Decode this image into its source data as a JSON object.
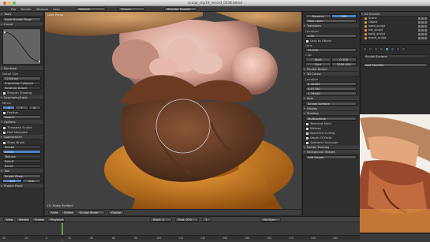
{
  "window": {
    "title": "sculpt_clip19_record_0038.blend"
  },
  "menubar": {
    "items": [
      "File",
      "Render",
      "Window",
      "Help"
    ],
    "layout": "Default",
    "scene": "Scene",
    "engine": "Blender Render"
  },
  "tool_panel": {
    "header": "Tools",
    "brush_field": "Input Sculpt Draw",
    "curve_title": "Curve",
    "dyntopo_title": "Dyntopo",
    "detail_size_label": "Detail Size",
    "detail_size_value": "12.00 px",
    "subdivide_option": "Subdivide Collapse",
    "relative_detail": "Relative Detail",
    "smooth_shading": "Smooth Shading",
    "symmetry_title": "Symmetry/Lock",
    "mirror_label": "Mirror",
    "mirror_axes": [
      "X",
      "Y",
      "Z"
    ],
    "feather_label": "Feather",
    "radial_label": "Radial",
    "options_title": "Options",
    "threaded_label": "Threaded Sculpt",
    "fast_nav_label": "Fast Navigate",
    "appearance_title": "Appearance",
    "show_brush": "Show Brush",
    "tool_title": "Tool",
    "project_title": "Project Paint",
    "fields": [
      "Stroke",
      "Direct",
      "Texture",
      "Falloff",
      "Brush"
    ],
    "bottom_fields": [
      "Sculpt Draw",
      "Add",
      "Sub"
    ]
  },
  "viewport": {
    "label": "User Persp",
    "object_label": "(1) Scalp Surface",
    "header": {
      "view": "View",
      "select": "Select",
      "mode": "Sculpt Mode",
      "global": "Global"
    }
  },
  "props_panel": {
    "buttons": [
      "Remove",
      "Add",
      "New Layer"
    ],
    "modifier_title": "Transform",
    "fields": [
      {
        "label": "Location:",
        "value": "0.00"
      },
      {
        "label": "Lock to Object",
        "value": ""
      },
      {
        "label": "Lens",
        "value": "35.000"
      },
      {
        "label": "Clip:",
        "value": ""
      },
      {
        "label": "Start",
        "value": "0.100"
      },
      {
        "label": "End",
        "value": "1000.000"
      }
    ],
    "sections": [
      "Render Border",
      "3D Cursor",
      "Location",
      "Item",
      "Display",
      "Shading",
      "Motion Tracking",
      "Background Images"
    ],
    "cursor": {
      "x": "0.30004",
      "y": "0.07750",
      "z": "1.76440"
    },
    "item_name": "Sculpt Surface",
    "matcap_label": "Multisample",
    "checks": [
      "Textured Solid",
      "Matcap",
      "Backface Culling",
      "Depth Of Field",
      "Ambient Occlusion"
    ],
    "add_image_button": "Add Image"
  },
  "outliner": {
    "title": "All Scenes",
    "items": [
      "Scene",
      "Object",
      "head_sculpt",
      "hat_sculpt",
      "body_sculpt",
      "beard_sculpt",
      "Sculpt Surface"
    ]
  },
  "right_props": {
    "object_name": "Sculpt Surface",
    "modifier_label": "Add Modifier"
  },
  "timeline": {
    "menus": [
      "View",
      "Marker",
      "Frame",
      "Playback"
    ],
    "start_label": "Start: 1",
    "end_label": "End: 250",
    "current_frame": "1",
    "sync": "No Sync",
    "ticks": [
      "-40",
      "-20",
      "0",
      "20",
      "40",
      "60",
      "80",
      "100",
      "120",
      "140",
      "160",
      "180",
      "200",
      "220",
      "240",
      "260"
    ]
  },
  "colors": {
    "accent": "#5680c2",
    "panel": "#2f2f2f",
    "playhead": "#5aa33a"
  }
}
